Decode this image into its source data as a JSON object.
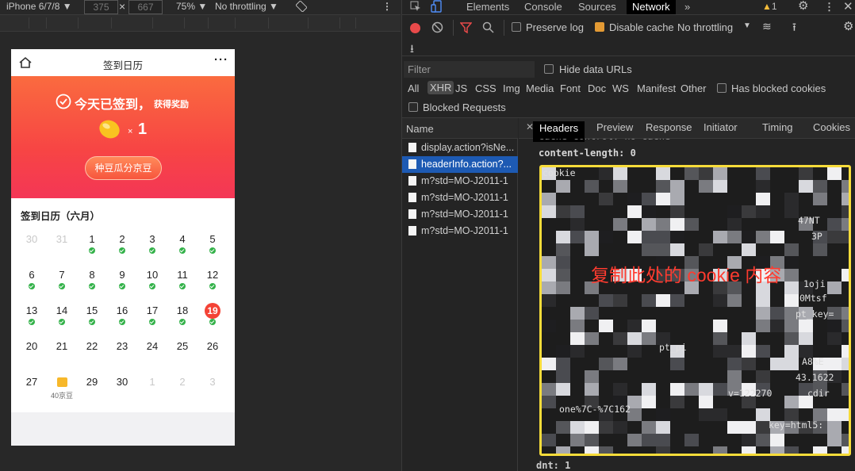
{
  "device_toolbar": {
    "device": "iPhone 6/7/8 ▼",
    "width": "375",
    "times": "×",
    "height": "667",
    "zoom": "75% ▼",
    "throttle": "No throttling ▼"
  },
  "phone": {
    "title": "签到日历",
    "more": "···",
    "banner_title": "今天已签到，",
    "banner_sub": "获得奖励",
    "reward_times": "×",
    "reward_count": "1",
    "cta": "种豆瓜分京豆",
    "calendar_title": "签到日历（六月）",
    "gift_label": "40京豆",
    "weeks": [
      [
        {
          "d": "30",
          "off": true
        },
        {
          "d": "31",
          "off": true
        },
        {
          "d": "1",
          "c": true
        },
        {
          "d": "2",
          "c": true
        },
        {
          "d": "3",
          "c": true
        },
        {
          "d": "4",
          "c": true
        },
        {
          "d": "5",
          "c": true
        }
      ],
      [
        {
          "d": "6",
          "c": true
        },
        {
          "d": "7",
          "c": true
        },
        {
          "d": "8",
          "c": true
        },
        {
          "d": "9",
          "c": true
        },
        {
          "d": "10",
          "c": true
        },
        {
          "d": "11",
          "c": true
        },
        {
          "d": "12",
          "c": true
        }
      ],
      [
        {
          "d": "13",
          "c": true
        },
        {
          "d": "14",
          "c": true
        },
        {
          "d": "15",
          "c": true
        },
        {
          "d": "16",
          "c": true
        },
        {
          "d": "17",
          "c": true
        },
        {
          "d": "18",
          "c": true
        },
        {
          "d": "19",
          "today": true,
          "c": true
        }
      ],
      [
        {
          "d": "20"
        },
        {
          "d": "21"
        },
        {
          "d": "22"
        },
        {
          "d": "23"
        },
        {
          "d": "24"
        },
        {
          "d": "25"
        },
        {
          "d": "26"
        }
      ],
      [
        {
          "d": "27"
        },
        {
          "d": "gift"
        },
        {
          "d": "29"
        },
        {
          "d": "30"
        },
        {
          "d": "1",
          "off": true
        },
        {
          "d": "2",
          "off": true
        },
        {
          "d": "3",
          "off": true
        }
      ]
    ]
  },
  "devtools": {
    "tabs": [
      "Elements",
      "Console",
      "Sources",
      "Network",
      "»"
    ],
    "active_tab": "Network",
    "warn_count": "1",
    "preserve_log": "Preserve log",
    "disable_cache": "Disable cache",
    "throttling": "No throttling",
    "filter_placeholder": "Filter",
    "hide_data_urls": "Hide data URLs",
    "types": [
      "All",
      "XHR",
      "JS",
      "CSS",
      "Img",
      "Media",
      "Font",
      "Doc",
      "WS",
      "Manifest",
      "Other"
    ],
    "active_type": "XHR",
    "has_blocked": "Has blocked cookies",
    "blocked_requests": "Blocked Requests",
    "name_header": "Name",
    "requests": [
      "display.action?isNe...",
      "headerInfo.action?...",
      "m?std=MO-J2011-1",
      "m?std=MO-J2011-1",
      "m?std=MO-J2011-1",
      "m?std=MO-J2011-1"
    ],
    "selected_request": 1,
    "detail_tabs": [
      "Headers",
      "Preview",
      "Response",
      "Initiator",
      "Timing",
      "Cookies"
    ],
    "active_detail_tab": "Headers",
    "header_line_top": "cache-control: no-cache",
    "content_length": "content-length: 0",
    "annotation": "复制此处的 cookie 内容",
    "visible_fragments": [
      "cookie",
      "47NT",
      "3P",
      "1oji",
      "0Mtsf",
      "pt_key=",
      "pt_pi",
      "A8%E",
      "43.1622",
      "v=122270",
      "cdir",
      "one%7C-%7C162",
      "key=html5:"
    ],
    "bottom_fragment": "dnt: 1"
  },
  "colors": {
    "accent": "#f74544",
    "highlight": "#f7dc3a",
    "annotation": "#ff3b2f"
  }
}
